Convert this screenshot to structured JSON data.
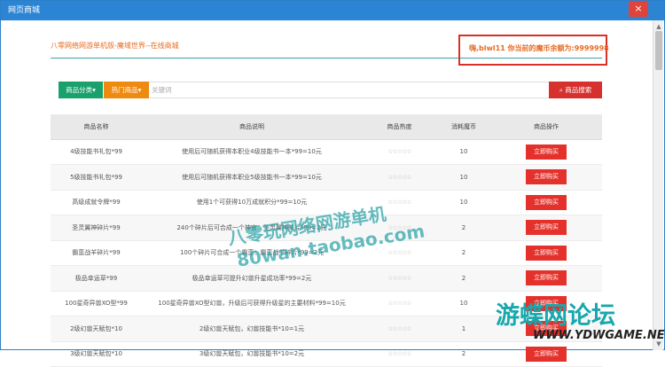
{
  "window": {
    "title": "网页商城",
    "close_glyph": "×"
  },
  "header": {
    "title": "八零网络网游单机版-魔域世界--在线商城",
    "balance": "嗨,blwl11 你当前的魔币余额为:9999998"
  },
  "search": {
    "category_label": "商品分类▾",
    "hot_label": "热门商品▾",
    "placeholder": "关键词",
    "button_label": "商品搜索"
  },
  "table": {
    "headers": [
      "商品名称",
      "商品说明",
      "商品热度",
      "消耗魔币",
      "商品操作"
    ],
    "rows": [
      {
        "name": "4级技能书礼包*99",
        "desc": "使用后可随机获得本职业4级技能书一本*99=10元",
        "heat": "☆☆☆☆☆",
        "coin": "10",
        "op": "立即购买"
      },
      {
        "name": "5级技能书礼包*99",
        "desc": "使用后可随机获得本职业5级技能书一本*99=10元",
        "heat": "☆☆☆☆☆",
        "coin": "10",
        "op": "立即购买"
      },
      {
        "name": "高级成就令牌*99",
        "desc": "使用1个可获得10万成就积分*99=10元",
        "heat": "☆☆☆☆☆",
        "coin": "10",
        "op": "立即购买"
      },
      {
        "name": "圣灵翼神碎片*99",
        "desc": "240个碎片后可合成一个神宫：圣灵翼神碎片*99=2元",
        "heat": "☆☆☆☆☆",
        "coin": "2",
        "op": "立即购买"
      },
      {
        "name": "霸蛮战羊碎片*99",
        "desc": "100个碎片可合成一个霸蛮：霸蛮战羊碎片*99=2元",
        "heat": "☆☆☆☆☆",
        "coin": "2",
        "op": "立即购买"
      },
      {
        "name": "极品幸运草*99",
        "desc": "极品幸运草可提升幻兽升星成功率*99=2元",
        "heat": "☆☆☆☆☆",
        "coin": "2",
        "op": "立即购买"
      },
      {
        "name": "100星奇异兽XO型*99",
        "desc": "100星奇异兽XO型幻兽，升级后可获得升级星的主要材料*99=10元",
        "heat": "☆☆☆☆☆",
        "coin": "10",
        "op": "立即购买"
      },
      {
        "name": "2级幻兽天赋包*10",
        "desc": "2级幻兽天赋包，幻兽技能书*10=1元",
        "heat": "☆☆☆☆☆",
        "coin": "1",
        "op": "立即购买"
      },
      {
        "name": "3级幻兽天赋包*10",
        "desc": "3级幻兽天赋包，幻兽技能书*10=2元",
        "heat": "☆☆☆☆☆",
        "coin": "2",
        "op": "立即购买"
      }
    ]
  },
  "watermark": {
    "line1": "八零玩网络网游单机",
    "line2": "80wan.taobao.com",
    "logo_cn": "游蝶网论坛",
    "logo_en": "WWW.YDWGAME.NET"
  },
  "colors": {
    "titlebar": "#2b85d4",
    "accent_orange": "#e86b22",
    "buy_red": "#e4312b",
    "category_green": "#19a06b",
    "hot_orange": "#ef8a11",
    "highlight_box": "#d93129"
  }
}
